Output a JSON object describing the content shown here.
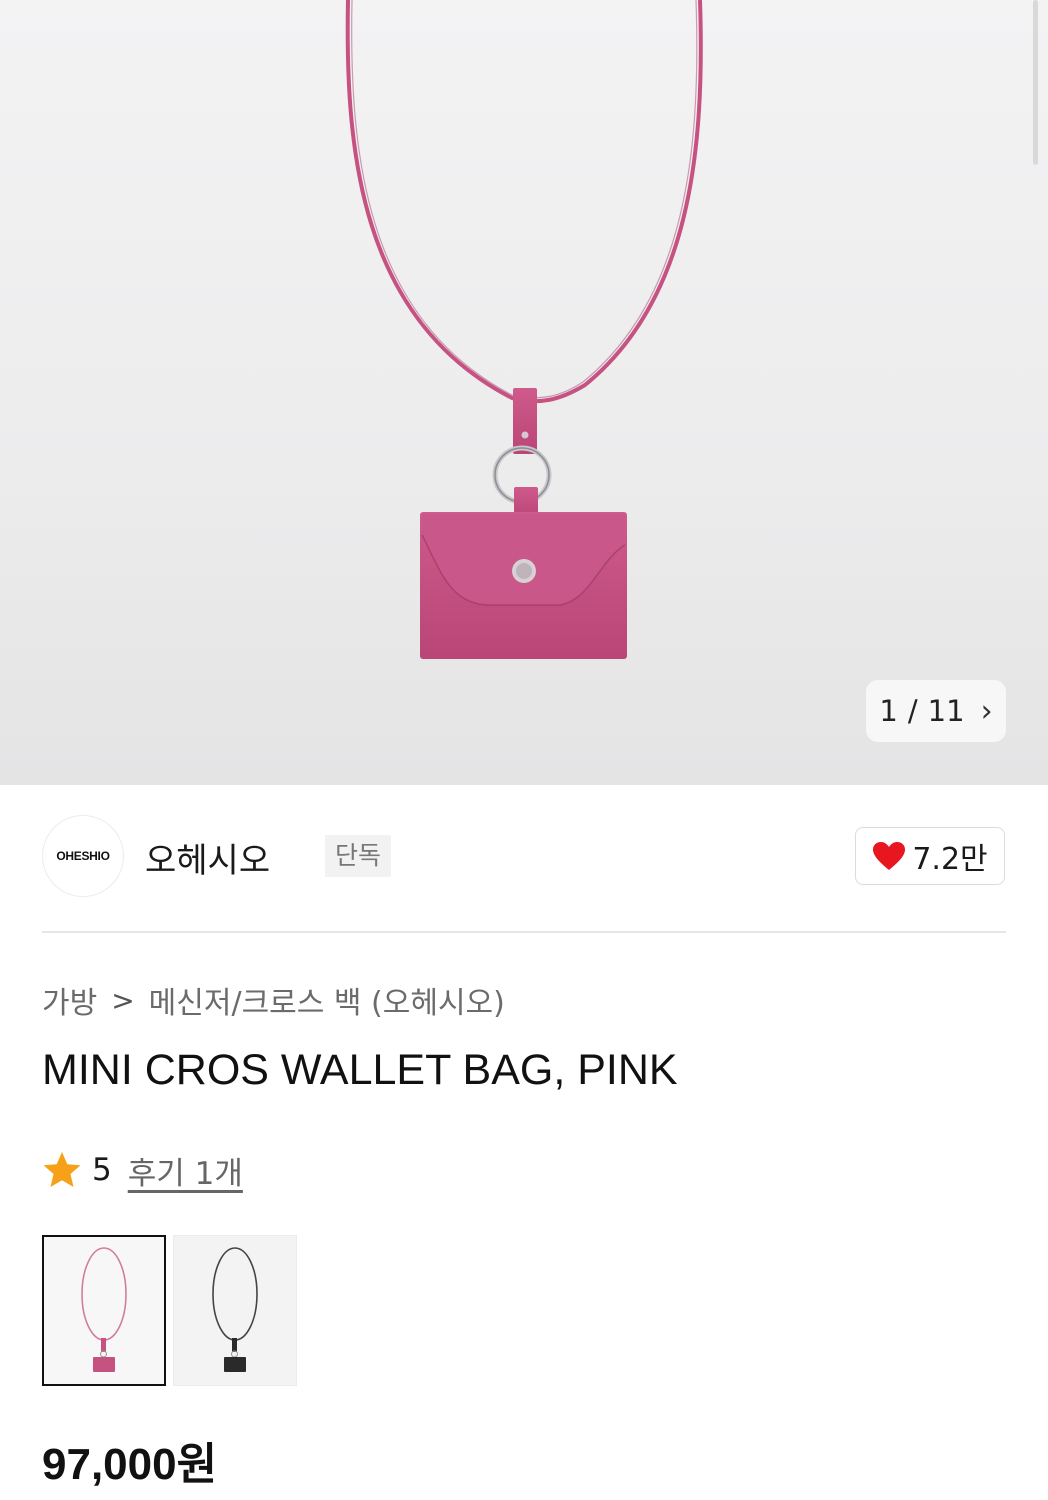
{
  "gallery": {
    "current_page": "1",
    "separator": "/",
    "total_pages": "11",
    "next_icon": "chevron-right-icon",
    "product_color": "#c65282"
  },
  "brand": {
    "logo_text": "OHESHIO",
    "name": "오헤시오",
    "badge": "단독",
    "like_icon": "heart-icon",
    "like_color": "#e8161e",
    "likes": "7.2만"
  },
  "breadcrumb": {
    "category": "가방",
    "separator": ">",
    "subcategory": "메신저/크로스 백 (오헤시오)"
  },
  "product": {
    "title": "MINI CROS WALLET BAG, PINK",
    "rating_icon": "star-icon",
    "rating_color": "#f7a119",
    "rating": "5",
    "reviews": "후기 1개",
    "price": "97,000원"
  },
  "variants": [
    {
      "color_name": "pink",
      "color": "#c65282",
      "selected": true
    },
    {
      "color_name": "black",
      "color": "#2a2a2a",
      "selected": false
    }
  ]
}
